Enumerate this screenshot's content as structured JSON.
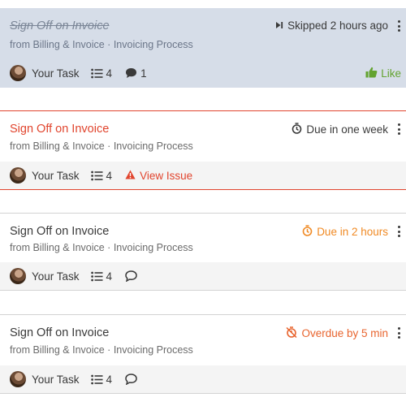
{
  "tasks": [
    {
      "title": "Sign Off on Invoice",
      "subtitle": "from Billing & Invoice · Invoicing Process",
      "status": "Skipped 2 hours ago",
      "status_icon": "skip-forward-icon",
      "assignee": "Your Task",
      "subtask_count": "4",
      "comment_count": "1",
      "like_label": "Like"
    },
    {
      "title": "Sign Off on Invoice",
      "subtitle": "from Billing & Invoice · Invoicing Process",
      "status": "Due in one week",
      "status_icon": "stopwatch-icon",
      "assignee": "Your Task",
      "subtask_count": "4",
      "issue_label": "View Issue"
    },
    {
      "title": "Sign Off on Invoice",
      "subtitle": "from Billing & Invoice · Invoicing Process",
      "status": "Due in 2 hours",
      "status_icon": "stopwatch-icon",
      "status_color": "#f08a24",
      "assignee": "Your Task",
      "subtask_count": "4"
    },
    {
      "title": "Sign Off on Invoice",
      "subtitle": "from Billing & Invoice · Invoicing Process",
      "status": "Overdue by 5 min",
      "status_icon": "stopwatch-off-icon",
      "status_color": "#e8642e",
      "assignee": "Your Task",
      "subtask_count": "4"
    }
  ],
  "colors": {
    "issue_red": "#e1452e",
    "like_green": "#63a330",
    "skipped_bg": "#d6dde8"
  }
}
